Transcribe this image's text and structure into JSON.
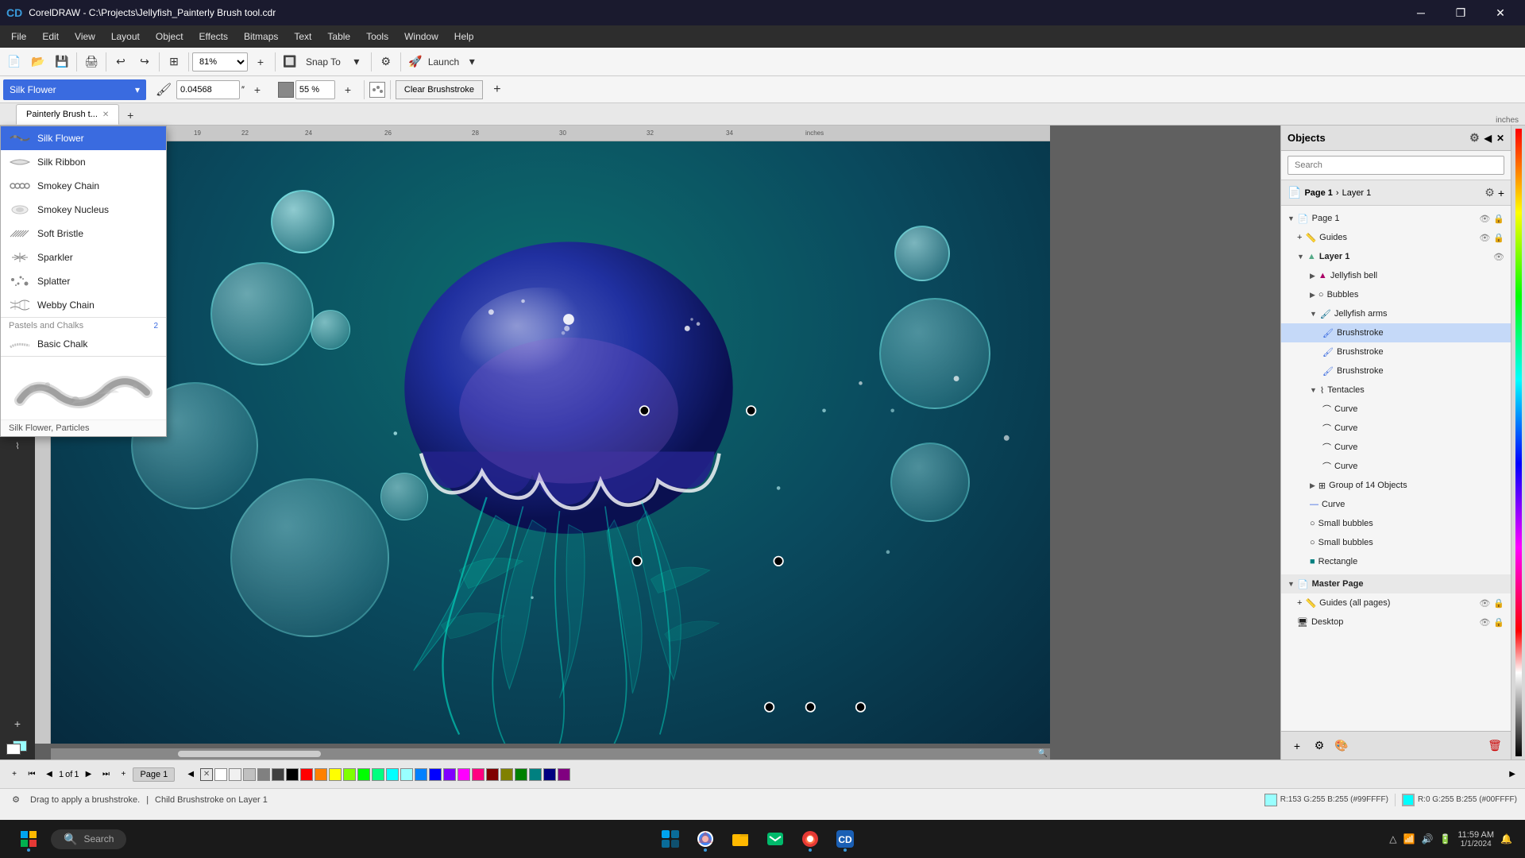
{
  "titlebar": {
    "title": "CorelDRAW - C:\\Projects\\Jellyfish_Painterly Brush tool.cdr",
    "logo": "CD",
    "min": "─",
    "restore": "❐",
    "close": "✕"
  },
  "menubar": {
    "items": [
      "File",
      "Edit",
      "View",
      "Layout",
      "Object",
      "Effects",
      "Bitmaps",
      "Text",
      "Table",
      "Tools",
      "Window",
      "Help"
    ]
  },
  "toolbar1": {
    "zoom": "81%",
    "snap_label": "Snap To",
    "launch_label": "Launch"
  },
  "toolbar2": {
    "brush_name": "Silk Flower",
    "brush_size": "0.04568",
    "opacity": "55 %",
    "clear_label": "Clear Brushstroke"
  },
  "tabs": [
    {
      "label": "Painterly Brush t...",
      "active": true
    }
  ],
  "brush_list": {
    "items": [
      {
        "name": "Silk Flower",
        "selected": true
      },
      {
        "name": "Silk Ribbon",
        "selected": false
      },
      {
        "name": "Smokey Chain",
        "selected": false
      },
      {
        "name": "Smokey Nucleus",
        "selected": false
      },
      {
        "name": "Soft Bristle",
        "selected": false
      },
      {
        "name": "Sparkler",
        "selected": false
      },
      {
        "name": "Splatter",
        "selected": false
      },
      {
        "name": "Webby Chain",
        "selected": false
      }
    ],
    "categories": [
      {
        "name": "Pastels and Chalks",
        "count": 2
      },
      {
        "name": "Basic Chalk",
        "count": 0
      }
    ],
    "preview_label": "Silk Flower, Particles"
  },
  "objects_panel": {
    "title": "Objects",
    "search_placeholder": "Search",
    "breadcrumb": {
      "page": "Page 1",
      "layer": "Layer 1"
    },
    "tree": [
      {
        "label": "Page 1",
        "level": 0,
        "expanded": true,
        "type": "page"
      },
      {
        "label": "Guides",
        "level": 1,
        "type": "guides"
      },
      {
        "label": "Layer 1",
        "level": 1,
        "expanded": true,
        "type": "layer"
      },
      {
        "label": "Jellyfish bell",
        "level": 2,
        "type": "group"
      },
      {
        "label": "Bubbles",
        "level": 2,
        "type": "group"
      },
      {
        "label": "Jellyfish arms",
        "level": 2,
        "expanded": true,
        "type": "group"
      },
      {
        "label": "Brushstroke",
        "level": 3,
        "selected": true,
        "type": "brushstroke"
      },
      {
        "label": "Brushstroke",
        "level": 3,
        "type": "brushstroke"
      },
      {
        "label": "Brushstroke",
        "level": 3,
        "type": "brushstroke"
      },
      {
        "label": "Tentacles",
        "level": 2,
        "expanded": true,
        "type": "group"
      },
      {
        "label": "Curve",
        "level": 3,
        "type": "curve"
      },
      {
        "label": "Curve",
        "level": 3,
        "type": "curve"
      },
      {
        "label": "Curve",
        "level": 3,
        "type": "curve"
      },
      {
        "label": "Curve",
        "level": 3,
        "type": "curve"
      },
      {
        "label": "Group of 14 Objects",
        "level": 2,
        "type": "group"
      },
      {
        "label": "Curve",
        "level": 2,
        "type": "curve_blue"
      },
      {
        "label": "Small bubbles",
        "level": 2,
        "type": "group"
      },
      {
        "label": "Small bubbles",
        "level": 2,
        "type": "group"
      },
      {
        "label": "Rectangle",
        "level": 2,
        "type": "rect_teal"
      },
      {
        "label": "Master Page",
        "level": 0,
        "type": "master"
      },
      {
        "label": "Guides (all pages)",
        "level": 1,
        "type": "guides"
      },
      {
        "label": "Desktop",
        "level": 1,
        "type": "desktop"
      }
    ]
  },
  "status_bar": {
    "left": "Drag to apply a brushstroke.",
    "middle": "Child Brushstroke on Layer 1",
    "color1_label": "R:153 G:255 B:255 (#99FFFF)",
    "color2_label": "R:0 G:255 B:255 (#00FFFF)"
  },
  "bottom_colors": [
    "#5b9bd5",
    "#70d0d0",
    "#8be0e0",
    "#a6f0f0",
    "#c1ffff",
    "#dde8e8",
    "#ffffff"
  ],
  "page_nav": {
    "current": "1",
    "total": "1",
    "page_label": "Page 1"
  },
  "taskbar": {
    "search_placeholder": "Search",
    "time": "...",
    "win_icon": "⊞"
  }
}
